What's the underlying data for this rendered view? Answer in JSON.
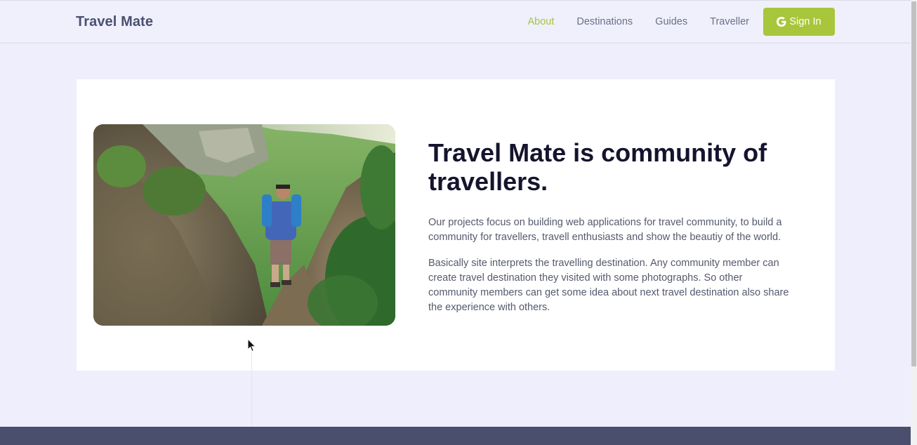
{
  "navbar": {
    "brand": "Travel Mate",
    "links": [
      {
        "label": "About",
        "active": true
      },
      {
        "label": "Destinations",
        "active": false
      },
      {
        "label": "Guides",
        "active": false
      },
      {
        "label": "Traveller",
        "active": false
      }
    ],
    "signin_label": "Sign In",
    "signin_icon": "google-icon"
  },
  "about": {
    "headline": "Travel Mate is community of travellers.",
    "paragraph_1": "Our projects focus on building web applications for travel community, to build a community for travellers, travell enthusiasts and show the beautiy of the world.",
    "paragraph_2": "Basically site interprets the travelling destination. Any community member can create travel destination they visited with some photographs. So other community members can get some idea about next travel destination also share the experience with others."
  },
  "colors": {
    "accent": "#a8c63b",
    "page_background": "#eeeefc",
    "brand_text": "#4a5070",
    "headline": "#14142e",
    "footer": "#4a4f6e"
  }
}
